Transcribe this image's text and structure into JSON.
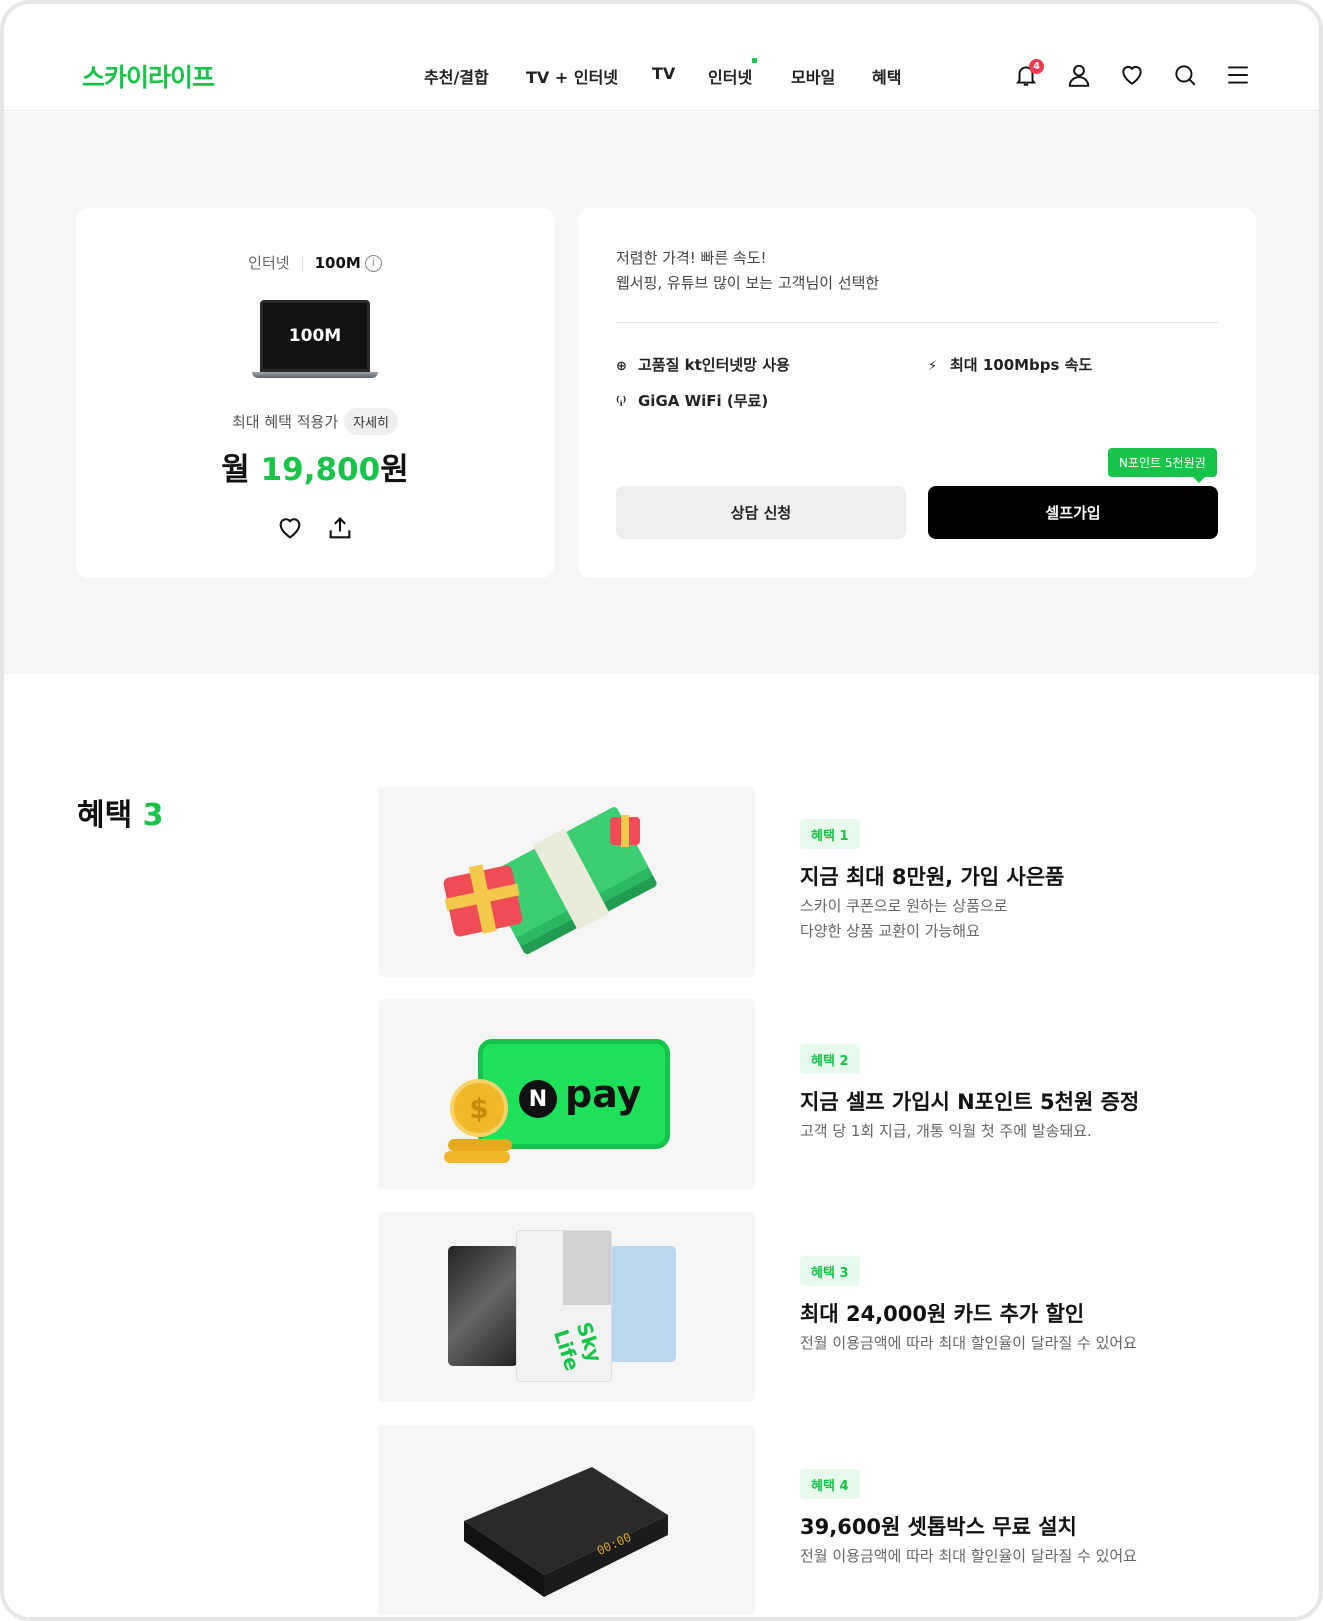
{
  "header": {
    "logo": "스카이라이프",
    "nav": [
      "추천/결합",
      "TV + 인터넷",
      "TV",
      "인터넷",
      "모바일",
      "혜택"
    ],
    "notification_count": "4",
    "icons": [
      "bell-icon",
      "user-icon",
      "heart-icon",
      "search-icon",
      "menu-icon"
    ]
  },
  "product": {
    "category": "인터넷",
    "speed": "100M",
    "device_label": "100M",
    "price_label": "최대 혜택 적용가",
    "detail_chip": "자세히",
    "price_prefix": "월 ",
    "price_value": "19,800",
    "price_suffix": "원"
  },
  "summary": {
    "line1": "저렴한 가격! 빠른 속도!",
    "line2": "웹서핑, 유튜브 많이 보는 고객님이 선택한",
    "features": [
      "고품질 kt인터넷망 사용",
      "최대 100Mbps 속도",
      "GiGA WiFi (무료)"
    ],
    "consult_button": "상담 신청",
    "self_button": "셀프가입",
    "npoint_tag": "N포인트 5천원권"
  },
  "benefits": {
    "title": "혜택 ",
    "count": "3",
    "items": [
      {
        "tag": "혜택 1",
        "title": "지금 최대 8만원, 가입 사은품",
        "desc1": "스카이 쿠폰으로 원하는 상품으로",
        "desc2": "다양한 상품 교환이 가능해요"
      },
      {
        "tag": "혜택 2",
        "title": "지금 셀프 가입시 N포인트 5천원 증정",
        "desc1": "고객 당 1회 지급, 개통 익월 첫 주에 발송돼요.",
        "desc2": ""
      },
      {
        "tag": "혜택 3",
        "title": "최대 24,000원 카드 추가 할인",
        "desc1": "전월 이용금액에 따라 최대 할인율이 달라질 수 있어요",
        "desc2": ""
      },
      {
        "tag": "혜택 4",
        "title": "39,600원 셋톱박스 무료 설치",
        "desc1": "전월 이용금액에 따라 최대 할인율이 달라질 수 있어요",
        "desc2": ""
      }
    ],
    "npay_logo": "pay",
    "npay_n": "N",
    "settop_display": "00:00",
    "card_brand": "Sky Life"
  }
}
